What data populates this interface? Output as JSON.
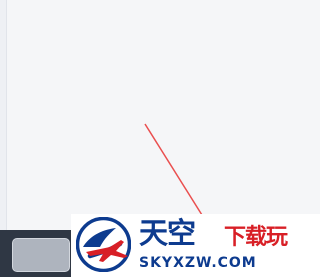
{
  "watermark": {
    "brand_cn_main": "天空",
    "brand_cn_accent": "下载玩",
    "brand_domain": "SKYXZW.COM"
  },
  "colors": {
    "brand_blue": "#0d3b8f",
    "brand_red": "#d81f26",
    "taskbar": "#2f3744",
    "pointer_line": "#ea4f4f"
  },
  "icons": {
    "logo": "airplane-globe-logo-icon"
  }
}
